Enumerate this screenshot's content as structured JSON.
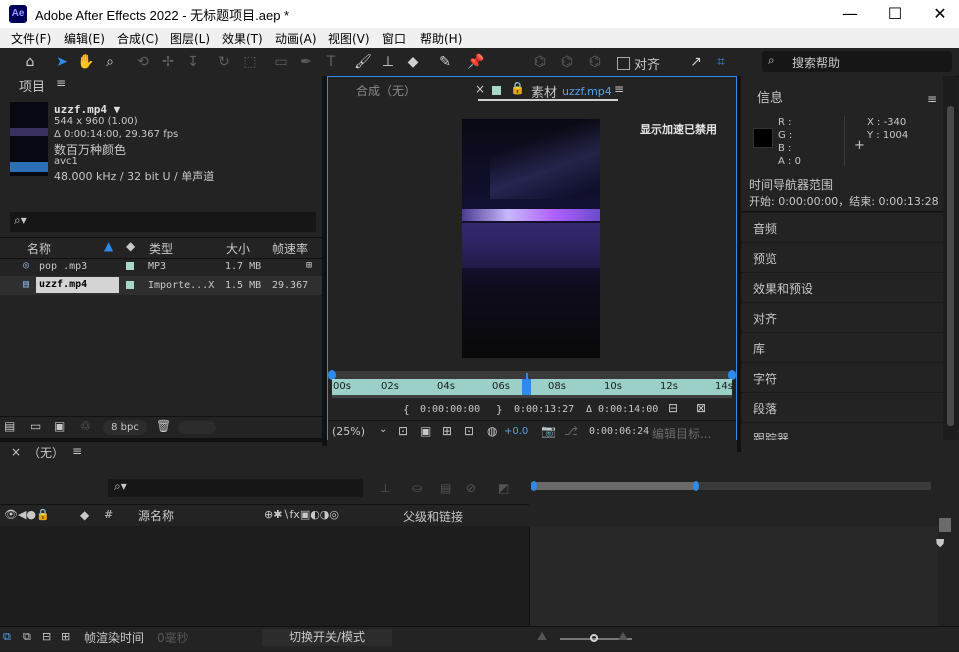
{
  "titlebar": {
    "app_icon": "Ae",
    "title": "Adobe After Effects 2022 - 无标题项目.aep *",
    "minimize": "—",
    "maximize": "☐",
    "close": "✕"
  },
  "menu": [
    "文件(F)",
    "编辑(E)",
    "合成(C)",
    "图层(L)",
    "效果(T)",
    "动画(A)",
    "视图(V)",
    "窗口",
    "帮助(H)"
  ],
  "toolbar": {
    "snap_label": "对齐",
    "search_placeholder": "搜索帮助"
  },
  "project": {
    "title": "项目",
    "file": {
      "name": "uzzf.mp4 ▼",
      "dims": "544 x 960 (1.00)",
      "duration": "Δ 0:00:14:00, 29.367 fps",
      "colors": "数百万种颜色",
      "codec": "avc1",
      "audio": "48.000 kHz / 32 bit U / 单声道"
    },
    "columns": {
      "name": "名称",
      "type": "类型",
      "size": "大小",
      "fps": "帧速率"
    },
    "rows": [
      {
        "name": "pop .mp3",
        "type": "MP3",
        "size": "1.7 MB",
        "fps": ""
      },
      {
        "name": "uzzf.mp4",
        "type": "Importe...X",
        "size": "1.5 MB",
        "fps": "29.367"
      }
    ],
    "bpc": "8 bpc"
  },
  "viewer": {
    "comp_tab": "合成（无）",
    "footage_tab": "素材",
    "footage_name": "uzzf.mp4",
    "accel_msg": "显示加速已禁用",
    "ruler": [
      "00s",
      "02s",
      "04s",
      "06s",
      "08s",
      "10s",
      "12s",
      "14s"
    ],
    "in_time": "0:00:00:00",
    "out_time": "0:00:13:27",
    "duration": "Δ 0:00:14:00",
    "zoom": "(25%)",
    "exposure": "+0.0",
    "current_time": "0:00:06:24",
    "edit_target": "编辑目标..."
  },
  "info": {
    "title": "信息",
    "r": "R :",
    "g": "G :",
    "b": "B :",
    "a": "A : 0",
    "x": "X : -340",
    "y": "Y : 1004",
    "nav_label": "时间导航器范围",
    "nav_range": "开始: 0:00:00:00，结束: 0:00:13:28",
    "sections": [
      "音频",
      "预览",
      "效果和预设",
      "对齐",
      "库",
      "字符",
      "段落",
      "跟踪器"
    ]
  },
  "timeline": {
    "tab": "（无）",
    "col_source": "源名称",
    "col_parent": "父级和链接",
    "render_label": "帧渲染时间",
    "render_value": "0毫秒",
    "toggle_label": "切换开关/模式"
  },
  "colors": {
    "accent": "#2d8ceb",
    "ruler": "#9bd0c8",
    "panel": "#232323"
  }
}
